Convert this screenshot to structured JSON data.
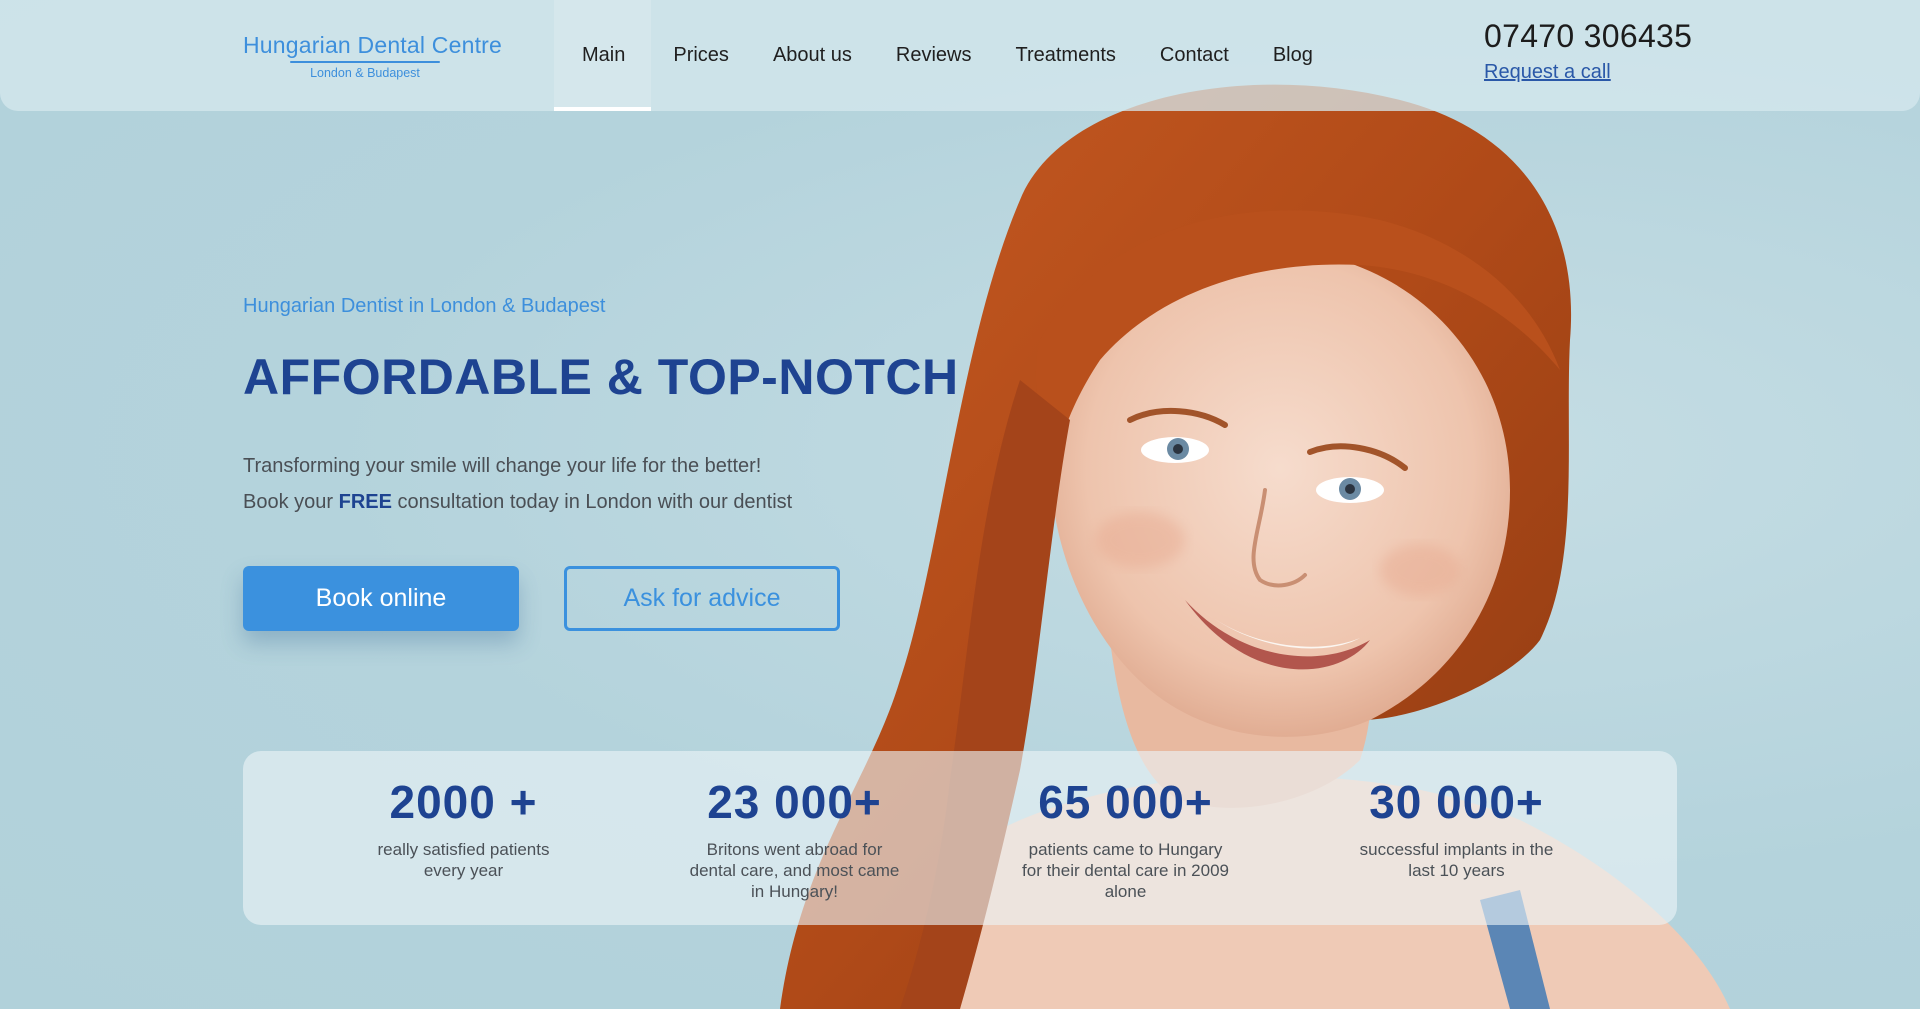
{
  "header": {
    "logo": {
      "title": "Hungarian Dental Centre",
      "subtitle": "London & Budapest"
    },
    "nav": [
      {
        "label": "Main",
        "active": true
      },
      {
        "label": "Prices",
        "active": false
      },
      {
        "label": "About us",
        "active": false
      },
      {
        "label": "Reviews",
        "active": false
      },
      {
        "label": "Treatments",
        "active": false
      },
      {
        "label": "Contact",
        "active": false
      },
      {
        "label": "Blog",
        "active": false
      }
    ],
    "phone": "07470 306435",
    "request_call": "Request a call"
  },
  "hero": {
    "tagline": "Hungarian Dentist in London & Budapest",
    "headline": "AFFORDABLE & TOP-NOTCH",
    "desc_line1": "Transforming your smile will change your life for the better!",
    "desc_line2_prefix": "Book your",
    "desc_line2_bold": "FREE",
    "desc_line2_suffix": "consultation today in London with our dentist",
    "book_button": "Book online",
    "advice_button": "Ask for advice",
    "image": "smiling-woman-portrait"
  },
  "stats": [
    {
      "value": "2000 +",
      "caption": "really satisfied patients every year"
    },
    {
      "value": "23 000+",
      "caption": "Britons went abroad for dental care, and most came in Hungary!"
    },
    {
      "value": "65 000+",
      "caption": "patients came to Hungary for their dental care in 2009 alone"
    },
    {
      "value": "30 000+",
      "caption": "successful implants in the last 10 years"
    }
  ],
  "colors": {
    "background": "#b4d3dc",
    "accent": "#3b91de",
    "headline": "#1e4391",
    "link": "#2a58a8"
  }
}
